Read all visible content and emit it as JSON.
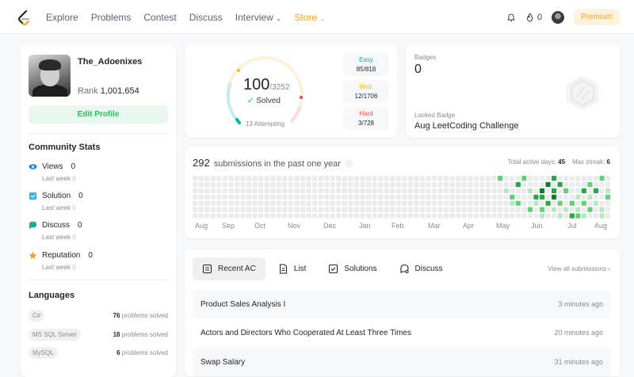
{
  "nav": {
    "links": [
      "Explore",
      "Problems",
      "Contest",
      "Discuss",
      "Interview",
      "Store"
    ],
    "notification_count": "0",
    "premium_label": "Premium"
  },
  "profile": {
    "username": "The_Adoenixes",
    "rank_label": "Rank",
    "rank_value": "1,001,654",
    "edit_label": "Edit Profile"
  },
  "community": {
    "title": "Community Stats",
    "items": [
      {
        "label": "Views",
        "value": "0",
        "sub_label": "Last week",
        "sub_value": "0",
        "icon": "eye-icon"
      },
      {
        "label": "Solution",
        "value": "0",
        "sub_label": "Last week",
        "sub_value": "0",
        "icon": "solution-icon"
      },
      {
        "label": "Discuss",
        "value": "0",
        "sub_label": "Last week",
        "sub_value": "0",
        "icon": "discuss-icon"
      },
      {
        "label": "Reputation",
        "value": "0",
        "sub_label": "Last week",
        "sub_value": "0",
        "icon": "star-icon"
      }
    ]
  },
  "languages": {
    "title": "Languages",
    "items": [
      {
        "name": "C#",
        "count": "76",
        "suffix": "problems solved"
      },
      {
        "name": "MS SQL Server",
        "count": "18",
        "suffix": "problems solved"
      },
      {
        "name": "MySQL",
        "count": "6",
        "suffix": "problems solved"
      }
    ]
  },
  "progress": {
    "solved": "100",
    "total": "/3252",
    "solved_label": "Solved",
    "attempting": "13 Attempting",
    "difficulty": [
      {
        "label": "Easy",
        "count": "85/818",
        "color": "#00b8a3"
      },
      {
        "label": "Med.",
        "count": "12/1706",
        "color": "#ffb800"
      },
      {
        "label": "Hard",
        "count": "3/728",
        "color": "#ef4743"
      }
    ]
  },
  "badges": {
    "label": "Badges",
    "count": "0",
    "locked_label": "Locked Badge",
    "locked_name": "Aug LeetCoding Challenge"
  },
  "submissions": {
    "count": "292",
    "title_text": "submissions in the past one year",
    "active_days_label": "Total active days:",
    "active_days": "45",
    "streak_label": "Max streak:",
    "streak": "6",
    "months": [
      "Aug",
      "Sep",
      "Oct",
      "Nov",
      "Dec",
      "Jan",
      "Feb",
      "Mar",
      "Apr",
      "May",
      "Jun",
      "Jul",
      "Aug"
    ]
  },
  "recent": {
    "tabs": [
      {
        "label": "Recent AC",
        "icon": "recent-ac-icon"
      },
      {
        "label": "List",
        "icon": "list-icon"
      },
      {
        "label": "Solutions",
        "icon": "solutions-icon"
      },
      {
        "label": "Discuss",
        "icon": "discuss-icon"
      }
    ],
    "view_all": "View all submissions",
    "rows": [
      {
        "title": "Product Sales Analysis I",
        "time": "3 minutes ago"
      },
      {
        "title": "Actors and Directors Who Cooperated At Least Three Times",
        "time": "20 minutes ago"
      },
      {
        "title": "Swap Salary",
        "time": "31 minutes ago"
      }
    ]
  },
  "colors": {
    "accent": "#ffa116",
    "green": "#2cbb5d",
    "easy": "#00b8a3",
    "medium": "#ffb800",
    "hard": "#ef4743"
  }
}
